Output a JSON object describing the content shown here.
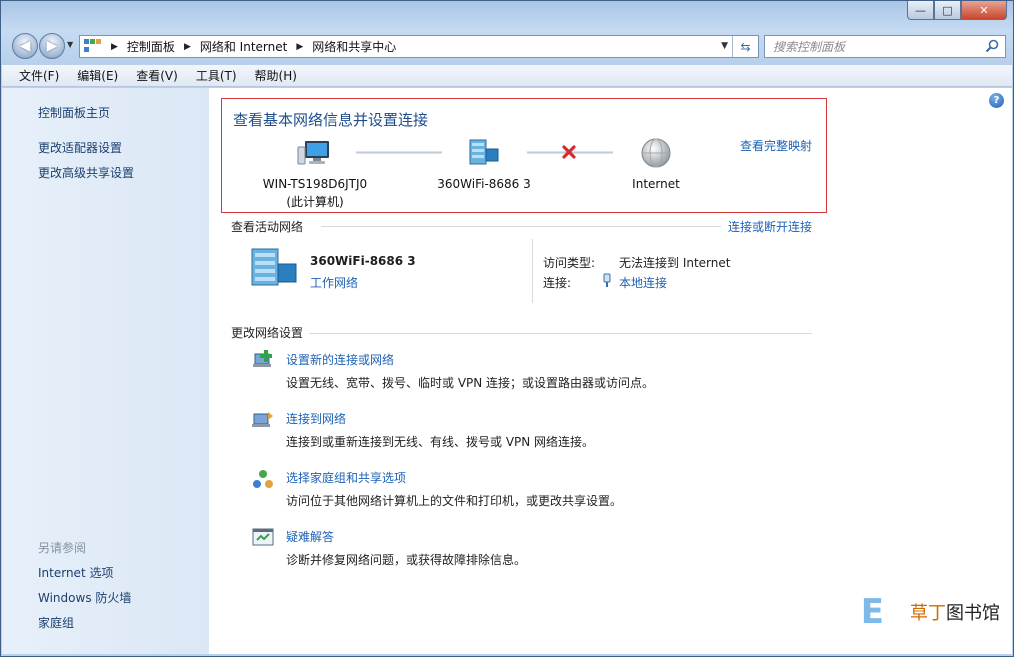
{
  "window": {
    "caption": {
      "minimize": "—",
      "maximize": "□",
      "close": "✕"
    }
  },
  "address_bar": {
    "breadcrumb": [
      "控制面板",
      "网络和 Internet",
      "网络和共享中心"
    ]
  },
  "search": {
    "placeholder": "搜索控制面板"
  },
  "menu": [
    "文件(F)",
    "编辑(E)",
    "查看(V)",
    "工具(T)",
    "帮助(H)"
  ],
  "left_pane": {
    "links": [
      "控制面板主页",
      "更改适配器设置",
      "更改高级共享设置"
    ],
    "see_also_title": "另请参阅",
    "see_also": [
      "Internet 选项",
      "Windows 防火墙",
      "家庭组"
    ]
  },
  "main": {
    "title": "查看基本网络信息并设置连接",
    "full_map_link": "查看完整映射",
    "nodes": [
      {
        "label": "WIN-TS198D6JTJ0",
        "sublabel": "(此计算机)"
      },
      {
        "label": "360WiFi-8686  3"
      },
      {
        "label": "Internet"
      }
    ],
    "active_networks": {
      "heading": "查看活动网络",
      "connect_link": "连接或断开连接",
      "network_name": "360WiFi-8686  3",
      "network_type": "工作网络",
      "access_label": "访问类型:",
      "access_value": "无法连接到 Internet",
      "connection_label": "连接:",
      "connection_value": "本地连接"
    },
    "change_settings": {
      "heading": "更改网络设置",
      "tasks": [
        {
          "title": "设置新的连接或网络",
          "desc": "设置无线、宽带、拨号、临时或 VPN 连接；或设置路由器或访问点。"
        },
        {
          "title": "连接到网络",
          "desc": "连接到或重新连接到无线、有线、拨号或 VPN 网络连接。"
        },
        {
          "title": "选择家庭组和共享选项",
          "desc": "访问位于其他网络计算机上的文件和打印机，或更改共享设置。"
        },
        {
          "title": "疑难解答",
          "desc": "诊断并修复网络问题，或获得故障排除信息。"
        }
      ]
    }
  },
  "watermark": {
    "brand": "草丁",
    "text": "图书馆"
  },
  "colors": {
    "link": "#1e62b4",
    "title": "#1e4e8c",
    "map_border": "#d53a3a"
  }
}
